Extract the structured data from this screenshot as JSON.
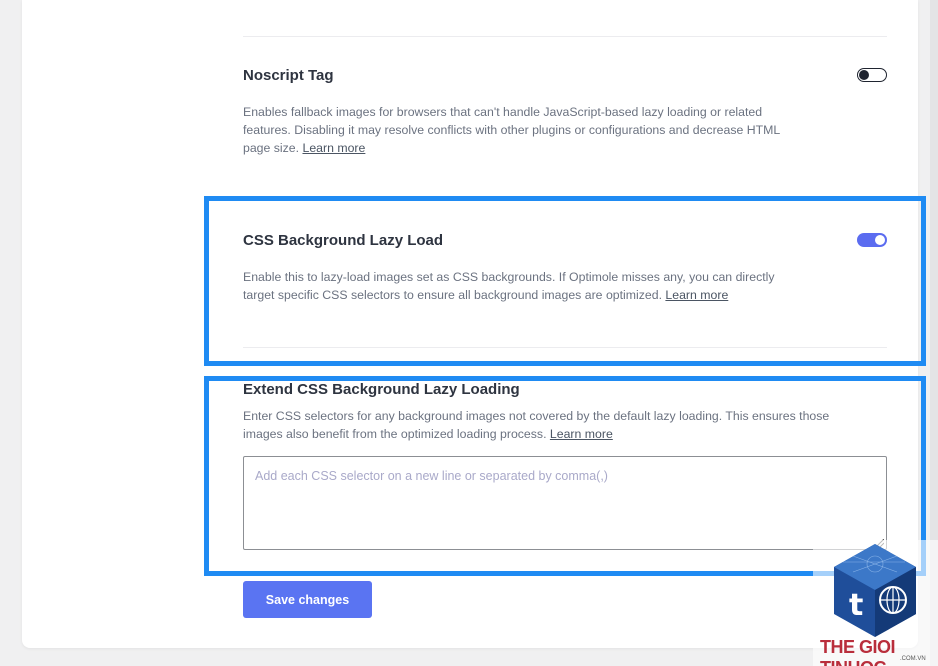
{
  "noscript": {
    "title": "Noscript Tag",
    "desc_1": "Enables fallback images for browsers that can't handle JavaScript-based lazy loading or related",
    "desc_2": "features. Disabling it may resolve conflicts with other plugins or configurations and decrease HTML",
    "desc_3": "page size.",
    "learn_more": "Learn more",
    "enabled": false
  },
  "css_bg": {
    "title": "CSS Background Lazy Load",
    "desc_1": "Enable this to lazy-load images set as CSS backgrounds. If Optimole misses any, you can directly",
    "desc_2": "target specific CSS selectors to ensure all background images are optimized.",
    "learn_more": "Learn more",
    "enabled": true
  },
  "extend_css": {
    "title": "Extend CSS Background Lazy Loading",
    "desc_1": "Enter CSS selectors for any background images not covered by the default lazy loading. This ensures those",
    "desc_2": "images also benefit from the optimized loading process.",
    "learn_more": "Learn more",
    "placeholder": "Add each CSS selector on a new line or separated by comma(,)",
    "value": ""
  },
  "save_label": "Save changes",
  "watermark": {
    "name": "THE GIOI TINHOC",
    "domain": ".COM.VN"
  },
  "colors": {
    "accent": "#5a74f2",
    "highlight": "#1f8bf3",
    "toggle_on": "#5b6cf0"
  }
}
